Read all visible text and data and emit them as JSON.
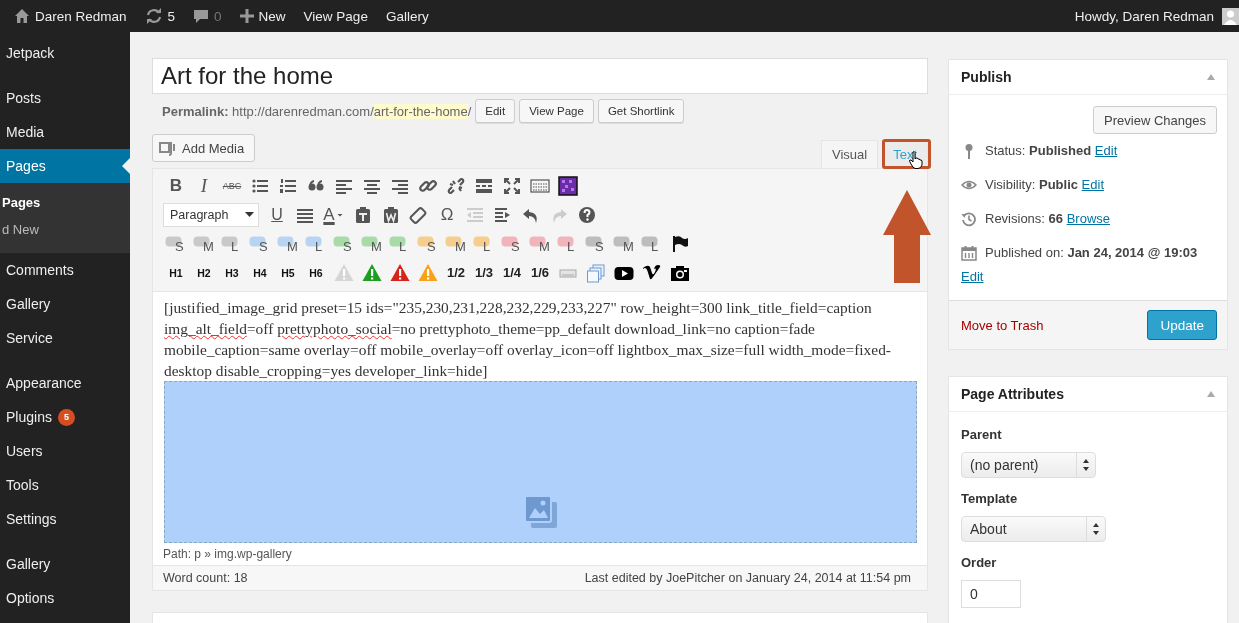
{
  "admin_bar": {
    "site_name": "Daren Redman",
    "updates_count": "5",
    "comments_count": "0",
    "new_label": "New",
    "links": [
      "View Page",
      "Gallery"
    ],
    "greeting": "Howdy, Daren Redman"
  },
  "sidebar": {
    "groups": [
      {
        "items": [
          {
            "label": "Jetpack",
            "selected": false
          }
        ]
      },
      {
        "items": [
          {
            "label": "Posts",
            "selected": false
          },
          {
            "label": "Media",
            "selected": false
          },
          {
            "label": "Pages",
            "selected": true,
            "children": [
              {
                "label": "Pages",
                "selected": true
              },
              {
                "label": "d New",
                "selected": false
              }
            ]
          },
          {
            "label": "Comments",
            "selected": false
          },
          {
            "label": "Gallery",
            "selected": false
          },
          {
            "label": "Service",
            "selected": false
          }
        ]
      },
      {
        "items": [
          {
            "label": "Appearance",
            "selected": false
          },
          {
            "label": "Plugins",
            "selected": false,
            "badge": "5"
          },
          {
            "label": "Users",
            "selected": false
          },
          {
            "label": "Tools",
            "selected": false
          },
          {
            "label": "Settings",
            "selected": false
          }
        ]
      },
      {
        "items": [
          {
            "label": "Gallery",
            "selected": false
          },
          {
            "label": "Options",
            "selected": false
          }
        ]
      }
    ]
  },
  "title": {
    "value": "Art for the home"
  },
  "permalink": {
    "label": "Permalink:",
    "base": "http://darenredman.com/",
    "slug": "art-for-the-home",
    "trailing": "/",
    "buttons": [
      "Edit",
      "View Page",
      "Get Shortlink"
    ]
  },
  "add_media": "Add Media",
  "editor_tabs": [
    {
      "label": "Visual",
      "selected": true
    },
    {
      "label": "Text",
      "selected": false
    }
  ],
  "toolbar": {
    "rows": [
      [
        {
          "kind": "glyph",
          "label": "B"
        },
        {
          "kind": "glyph",
          "label": "I"
        },
        {
          "kind": "glyph",
          "label": "ABC"
        },
        {
          "kind": "icon"
        },
        {
          "kind": "icon"
        },
        {
          "kind": "icon"
        },
        {
          "kind": "icon"
        },
        {
          "kind": "icon"
        },
        {
          "kind": "icon"
        },
        {
          "kind": "icon"
        },
        {
          "kind": "icon"
        },
        {
          "kind": "icon"
        },
        {
          "kind": "icon"
        },
        {
          "kind": "icon"
        },
        {
          "kind": "icon"
        }
      ],
      [
        {
          "kind": "select",
          "label": "Paragraph",
          "disabled": false
        },
        {
          "kind": "glyph",
          "label": "U",
          "disabled": false
        },
        {
          "kind": "icon",
          "disabled": false
        },
        {
          "kind": "glyph",
          "label": "A",
          "disabled": false
        },
        {
          "kind": "icon",
          "disabled": false
        },
        {
          "kind": "icon",
          "disabled": false
        },
        {
          "kind": "icon",
          "disabled": false
        },
        {
          "kind": "icon",
          "disabled": false
        },
        {
          "kind": "glyph",
          "label": "Ω",
          "disabled": false
        },
        {
          "kind": "icon",
          "disabled": true
        },
        {
          "kind": "icon",
          "disabled": false
        },
        {
          "kind": "icon",
          "disabled": false
        },
        {
          "kind": "icon",
          "disabled": true
        },
        {
          "kind": "icon",
          "disabled": false
        }
      ],
      [
        {
          "kind": "bubble",
          "label": "S",
          "color": "#c9c9c9"
        },
        {
          "kind": "bubble",
          "label": "M",
          "color": "#c9c9c9"
        },
        {
          "kind": "bubble",
          "label": "L",
          "color": "#c9c9c9"
        },
        {
          "kind": "bubble",
          "label": "S",
          "color": "#b9d3f2"
        },
        {
          "kind": "bubble",
          "label": "M",
          "color": "#b9d3f2"
        },
        {
          "kind": "bubble",
          "label": "L",
          "color": "#b9d3f2"
        },
        {
          "kind": "bubble",
          "label": "S",
          "color": "#a9dba9"
        },
        {
          "kind": "bubble",
          "label": "M",
          "color": "#a9dba9"
        },
        {
          "kind": "bubble",
          "label": "L",
          "color": "#a9dba9"
        },
        {
          "kind": "bubble",
          "label": "S",
          "color": "#f6cd8c"
        },
        {
          "kind": "bubble",
          "label": "M",
          "color": "#f6cd8c"
        },
        {
          "kind": "bubble",
          "label": "L",
          "color": "#f6cd8c"
        },
        {
          "kind": "bubble",
          "label": "S",
          "color": "#f2b3bb"
        },
        {
          "kind": "bubble",
          "label": "M",
          "color": "#f2b3bb"
        },
        {
          "kind": "bubble",
          "label": "L",
          "color": "#f2b3bb"
        },
        {
          "kind": "bubble",
          "label": "S",
          "color": "#bdbdbd"
        },
        {
          "kind": "bubble",
          "label": "M",
          "color": "#bdbdbd"
        },
        {
          "kind": "bubble",
          "label": "L",
          "color": "#bdbdbd"
        },
        {
          "kind": "icon"
        }
      ],
      [
        {
          "kind": "heading",
          "label": "H1"
        },
        {
          "kind": "heading",
          "label": "H2"
        },
        {
          "kind": "heading",
          "label": "H3"
        },
        {
          "kind": "heading",
          "label": "H4"
        },
        {
          "kind": "heading",
          "label": "H5"
        },
        {
          "kind": "heading",
          "label": "H6"
        },
        {
          "kind": "alert",
          "color": "#d6d6d6"
        },
        {
          "kind": "alert",
          "color": "#1e9e1e"
        },
        {
          "kind": "alert",
          "color": "#d8231b"
        },
        {
          "kind": "alert",
          "color": "#f7a21b"
        },
        {
          "kind": "fraction",
          "label": "1/2"
        },
        {
          "kind": "fraction",
          "label": "1/3"
        },
        {
          "kind": "fraction",
          "label": "1/4"
        },
        {
          "kind": "fraction",
          "label": "1/6"
        },
        {
          "kind": "icon"
        },
        {
          "kind": "icon"
        },
        {
          "kind": "icon"
        },
        {
          "kind": "icon"
        },
        {
          "kind": "icon"
        }
      ]
    ]
  },
  "content": {
    "segments": [
      {
        "text": "[justified_image_grid preset=15 ids=\"235,230,231,228,232,229,233,227\" row_height=300 link_title_field=caption ",
        "misspelled": false
      },
      {
        "text": "img_alt_field",
        "misspelled": true
      },
      {
        "text": "=off ",
        "misspelled": false
      },
      {
        "text": "prettyphoto_social",
        "misspelled": true
      },
      {
        "text": "=no prettyphoto_theme=pp_default download_link=no caption=fade mobile_caption=same overlay=off mobile_overlay=off overlay_icon=off lightbox_max_size=full width_mode=fixed-desktop disable_cropping=yes developer_link=hide]",
        "misspelled": false
      }
    ]
  },
  "path": "Path: p » img.wp-gallery",
  "word_count": "Word count: 18",
  "last_edited": "Last edited by JoePitcher on January 24, 2014 at 11:54 pm",
  "publish": {
    "title": "Publish",
    "preview": "Preview Changes",
    "rows": [
      {
        "kind": "status",
        "label": "Status:",
        "value": "Published",
        "link": "Edit"
      },
      {
        "kind": "visibility",
        "label": "Visibility:",
        "value": "Public",
        "link": "Edit"
      },
      {
        "kind": "revisions",
        "label": "Revisions:",
        "value": "66",
        "link": "Browse"
      },
      {
        "kind": "date",
        "label": "Published on:",
        "value": "Jan 24, 2014 @ 19:03",
        "link": "Edit"
      }
    ],
    "trash": "Move to Trash",
    "update": "Update"
  },
  "page_attributes": {
    "title": "Page Attributes",
    "fields": [
      {
        "kind": "select",
        "label": "Parent",
        "value": "(no parent)"
      },
      {
        "kind": "select",
        "label": "Template",
        "value": "About"
      },
      {
        "kind": "input",
        "label": "Order",
        "value": "0"
      }
    ]
  }
}
